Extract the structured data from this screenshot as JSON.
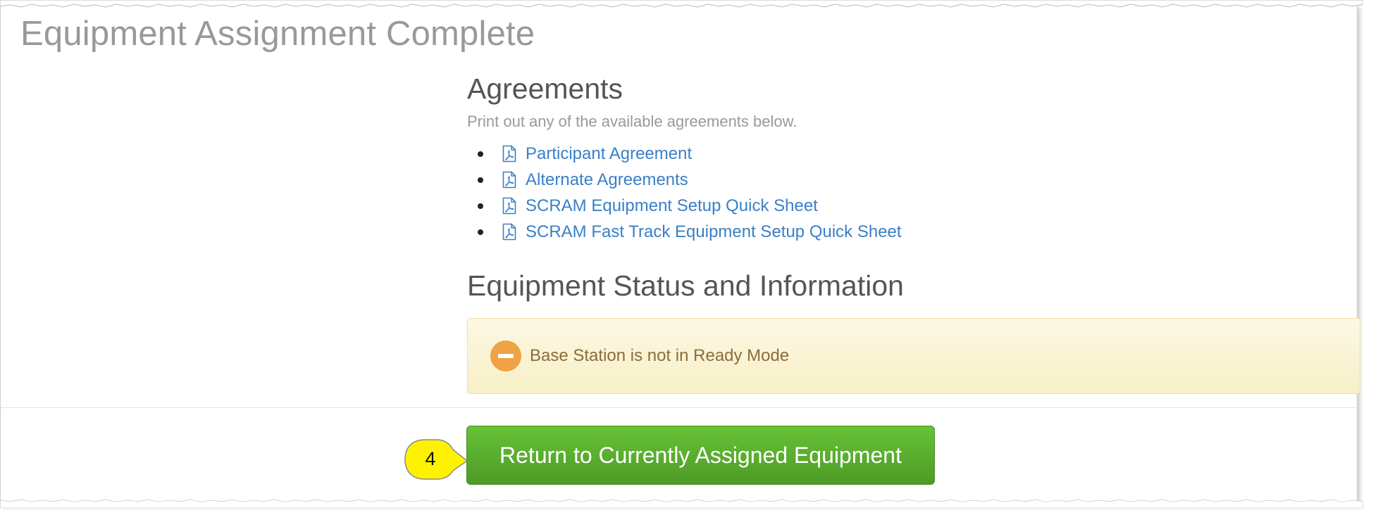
{
  "page": {
    "title": "Equipment Assignment Complete"
  },
  "agreements": {
    "title": "Agreements",
    "subtitle": "Print out any of the available agreements below.",
    "items": [
      {
        "label": "Participant Agreement",
        "icon": "pdf-file-icon"
      },
      {
        "label": "Alternate Agreements",
        "icon": "pdf-file-icon"
      },
      {
        "label": "SCRAM Equipment Setup Quick Sheet",
        "icon": "pdf-file-icon"
      },
      {
        "label": "SCRAM Fast Track Equipment Setup Quick Sheet",
        "icon": "pdf-file-icon"
      }
    ]
  },
  "status": {
    "title": "Equipment Status and Information",
    "alert": {
      "icon": "minus-circle-icon",
      "text": "Base Station is not in Ready Mode"
    }
  },
  "actions": {
    "return_label": "Return to Currently Assigned Equipment"
  },
  "callout": {
    "number": "4"
  },
  "colors": {
    "link": "#3a7fc7",
    "title_gray": "#999999",
    "heading": "#555555",
    "alert_bg": "#fcf8e3",
    "alert_icon": "#efa344",
    "alert_text": "#8a6d3b",
    "button_green": "#5cb531",
    "callout_yellow": "#fff200"
  }
}
